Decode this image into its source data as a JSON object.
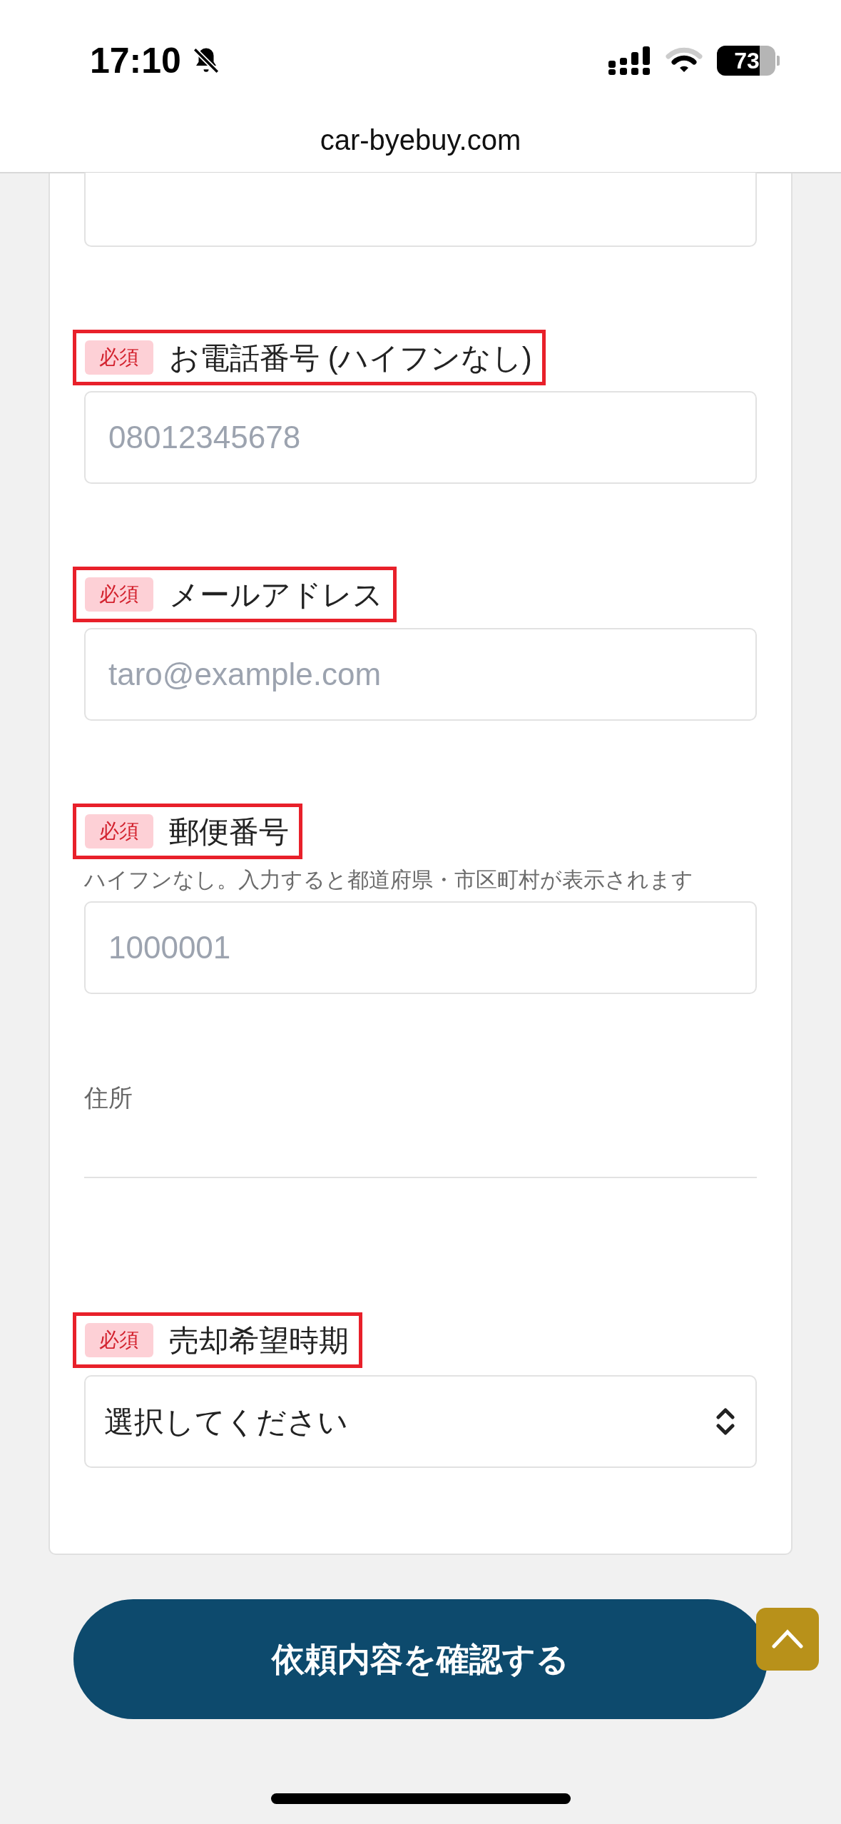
{
  "status_bar": {
    "time": "17:10",
    "battery": "73"
  },
  "browser": {
    "url": "car-byebuy.com"
  },
  "form": {
    "fields": [
      {
        "kind": "text",
        "cut_off": true
      },
      {
        "kind": "text",
        "label": "お電話番号 (ハイフンなし)",
        "required": true,
        "highlighted": true,
        "badge": "必須",
        "placeholder": "08012345678"
      },
      {
        "kind": "text",
        "label": "メールアドレス",
        "required": true,
        "highlighted": true,
        "badge": "必須",
        "placeholder": "taro@example.com"
      },
      {
        "kind": "text",
        "label": "郵便番号",
        "required": true,
        "highlighted": true,
        "badge": "必須",
        "hint": "ハイフンなし。入力すると都道府県・市区町村が表示されます",
        "placeholder": "1000001"
      },
      {
        "kind": "address",
        "label": "住所",
        "required": false,
        "highlighted": false
      },
      {
        "kind": "select",
        "label": "売却希望時期",
        "required": true,
        "highlighted": true,
        "badge": "必須",
        "value": "選択してください"
      }
    ]
  },
  "submit_button": "依頼内容を確認する"
}
